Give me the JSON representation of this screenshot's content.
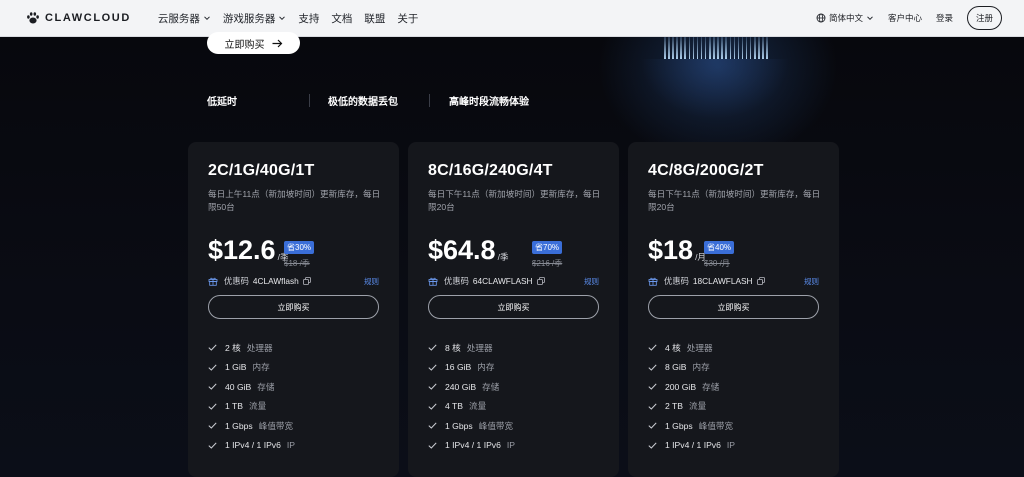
{
  "nav": {
    "logo_text": "CLAWCLOUD",
    "links": [
      {
        "label": "云服务器",
        "dropdown": true
      },
      {
        "label": "游戏服务器",
        "dropdown": true
      },
      {
        "label": "支持",
        "dropdown": false
      },
      {
        "label": "文档",
        "dropdown": false
      },
      {
        "label": "联盟",
        "dropdown": false
      },
      {
        "label": "关于",
        "dropdown": false
      }
    ],
    "language": "简体中文",
    "customer_center": "客户中心",
    "login": "登录",
    "register": "注册"
  },
  "hero": {
    "buy_label": "立即购买",
    "features": [
      "低延时",
      "极低的数据丢包",
      "高峰时段流畅体验"
    ]
  },
  "plans": [
    {
      "title": "2C/1G/40G/1T",
      "desc": "每日上午11点（新加坡时间）更新库存，每日限50台",
      "price": "$12.6",
      "unit": "/季",
      "discount": "省30%",
      "original": "$18 /季",
      "coupon_label": "优惠码",
      "coupon_code": "4CLAWflash",
      "rules": "规则",
      "buy": "立即购买",
      "specs": [
        {
          "value": "2 核",
          "label": "处理器"
        },
        {
          "value": "1 GiB",
          "label": "内存"
        },
        {
          "value": "40 GiB",
          "label": "存储"
        },
        {
          "value": "1 TB",
          "label": "流量"
        },
        {
          "value": "1 Gbps",
          "label": "峰值带宽"
        },
        {
          "value": "1 IPv4 / 1 IPv6",
          "label": "IP"
        }
      ]
    },
    {
      "title": "8C/16G/240G/4T",
      "desc": "每日下午11点（新加坡时间）更新库存，每日限20台",
      "price": "$64.8",
      "unit": "/季",
      "discount": "省70%",
      "original": "$216 /季",
      "coupon_label": "优惠码",
      "coupon_code": "64CLAWFLASH",
      "rules": "规则",
      "buy": "立即购买",
      "specs": [
        {
          "value": "8 核",
          "label": "处理器"
        },
        {
          "value": "16 GiB",
          "label": "内存"
        },
        {
          "value": "240 GiB",
          "label": "存储"
        },
        {
          "value": "4 TB",
          "label": "流量"
        },
        {
          "value": "1 Gbps",
          "label": "峰值带宽"
        },
        {
          "value": "1 IPv4 / 1 IPv6",
          "label": "IP"
        }
      ]
    },
    {
      "title": "4C/8G/200G/2T",
      "desc": "每日下午11点（新加坡时间）更新库存，每日限20台",
      "price": "$18",
      "unit": "/月",
      "discount": "省40%",
      "original": "$30 /月",
      "coupon_label": "优惠码",
      "coupon_code": "18CLAWFLASH",
      "rules": "规则",
      "buy": "立即购买",
      "specs": [
        {
          "value": "4 核",
          "label": "处理器"
        },
        {
          "value": "8 GiB",
          "label": "内存"
        },
        {
          "value": "200 GiB",
          "label": "存储"
        },
        {
          "value": "2 TB",
          "label": "流量"
        },
        {
          "value": "1 Gbps",
          "label": "峰值带宽"
        },
        {
          "value": "1 IPv4 / 1 IPv6",
          "label": "IP"
        }
      ]
    }
  ],
  "colors": {
    "background": "#06070c",
    "card": "#15171c",
    "accent_badge": "#3a6ed8",
    "rules_link": "#5b8ef0"
  }
}
